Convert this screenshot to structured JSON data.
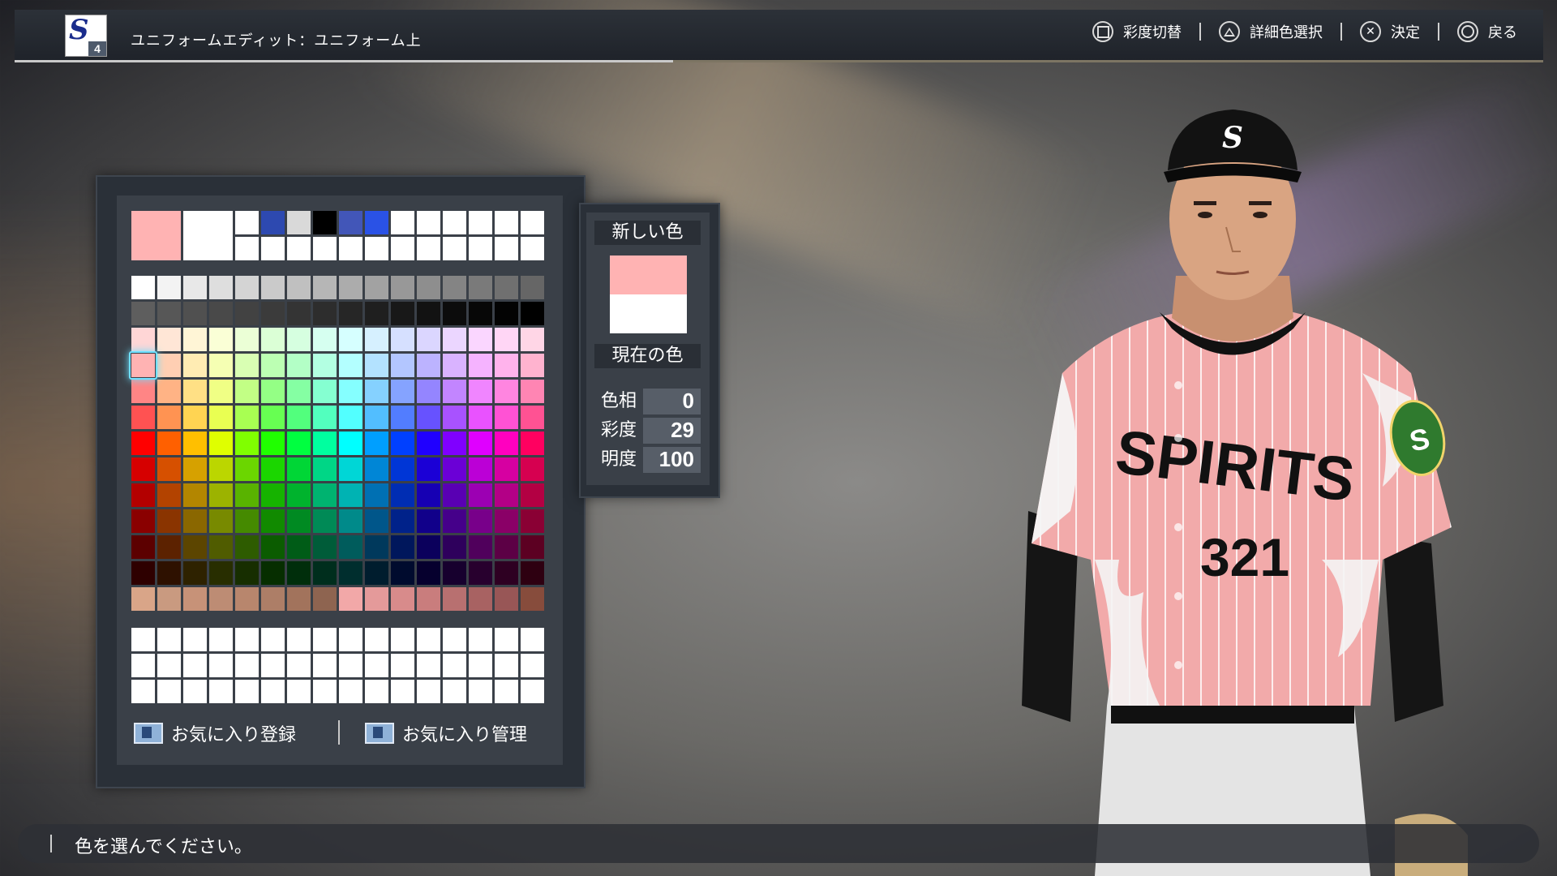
{
  "header": {
    "logo_letter": "S",
    "logo_number": "4",
    "title": "ユニフォームエディット：ユニフォーム上",
    "controls": [
      {
        "icon": "square-button-icon",
        "label": "彩度切替"
      },
      {
        "icon": "triangle-button-icon",
        "label": "詳細色選択"
      },
      {
        "icon": "cross-button-icon",
        "label": "決定"
      },
      {
        "icon": "circle-button-icon",
        "label": "戻る"
      }
    ]
  },
  "palette": {
    "top_large": [
      "#ffb3b3",
      "#ffffff"
    ],
    "top_small": [
      [
        "#ffffff",
        "#2d49b0",
        "#d9d9d9",
        "#000000",
        "#4256b8",
        "#2a52e6",
        "#ffffff",
        "#ffffff",
        "#ffffff",
        "#ffffff",
        "#ffffff",
        "#ffffff"
      ],
      [
        "#ffffff",
        "#ffffff",
        "#ffffff",
        "#ffffff",
        "#ffffff",
        "#ffffff",
        "#ffffff",
        "#ffffff",
        "#ffffff",
        "#ffffff",
        "#ffffff",
        "#ffffff"
      ]
    ],
    "gray_row_1": [
      "#ffffff",
      "#f3f3f3",
      "#e8e8e8",
      "#dedede",
      "#d4d4d4",
      "#cacaca",
      "#c0c0c0",
      "#b6b6b6",
      "#acacac",
      "#a2a2a2",
      "#989898",
      "#8e8e8e",
      "#848484",
      "#7a7a7a",
      "#707070",
      "#666666"
    ],
    "gray_row_2": [
      "#5e5e5e",
      "#575757",
      "#505050",
      "#494949",
      "#424242",
      "#3b3b3b",
      "#343434",
      "#2d2d2d",
      "#262626",
      "#1f1f1f",
      "#181818",
      "#121212",
      "#0c0c0c",
      "#070707",
      "#030303",
      "#000000"
    ],
    "hue_rows": 10,
    "hue_columns": 16,
    "skin_row": [
      "#d9a588",
      "#c99a80",
      "#c79278",
      "#bd8c74",
      "#b8866d",
      "#ad7e67",
      "#a2735c",
      "#8e6450",
      "#f2a8a8",
      "#e49a9a",
      "#d88b8b",
      "#c97d7d",
      "#b87070",
      "#a86262",
      "#985656",
      "#874c3c"
    ],
    "selected_hue": 0,
    "selected_saturation": 29,
    "selected_value": 100,
    "favorites_rows": 3,
    "favorites_columns": 16,
    "favorite_register_label": "お気に入り登録",
    "favorite_manage_label": "お気に入り管理"
  },
  "color_info": {
    "new_color_label": "新しい色",
    "current_color_label": "現在の色",
    "new_color": "#ffb3b3",
    "current_color": "#ffffff",
    "hue_label": "色相",
    "hue_value": "0",
    "saturation_label": "彩度",
    "saturation_value": "29",
    "brightness_label": "明度",
    "brightness_value": "100"
  },
  "player": {
    "cap_letter": "S",
    "jersey_text": "SPIRITS",
    "number": "321",
    "sleeve_patch_letter": "S",
    "jersey_color": "#f2aaaa"
  },
  "message": {
    "text": "色を選んでください。"
  }
}
